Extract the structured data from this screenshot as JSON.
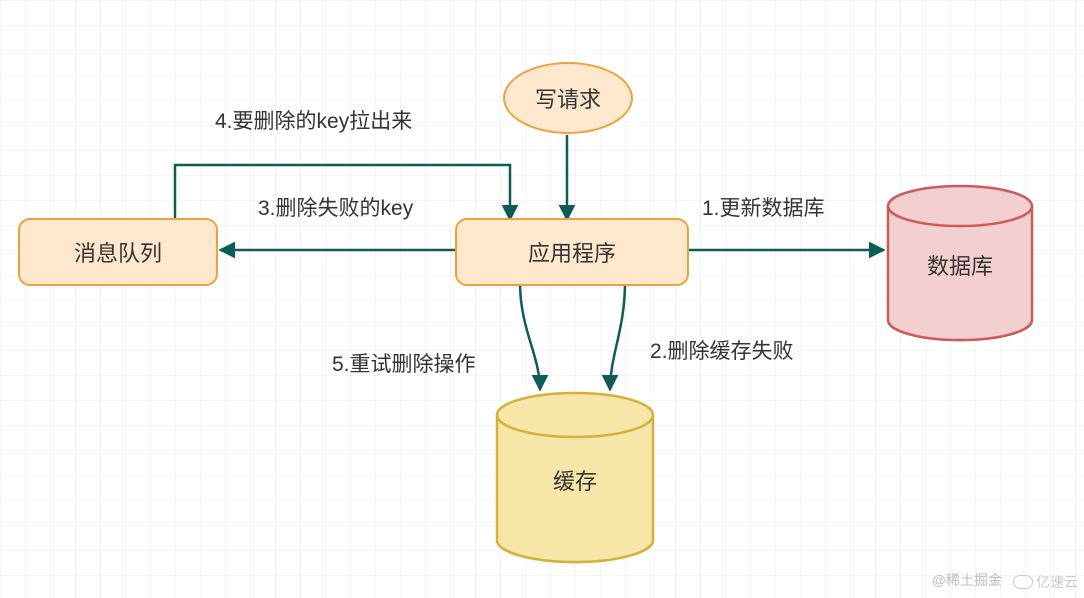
{
  "nodes": {
    "write_request": "写请求",
    "message_queue": "消息队列",
    "application": "应用程序",
    "database": "数据库",
    "cache": "缓存"
  },
  "edges": {
    "e1": "1.更新数据库",
    "e2": "2.删除缓存失败",
    "e3": "3.删除失败的key",
    "e4": "4.要删除的key拉出来",
    "e5": "5.重试删除操作"
  },
  "watermarks": {
    "w1": "@稀土掘金",
    "w2": "亿速云"
  },
  "colors": {
    "stroke": "#0d5c55",
    "orange_fill": "#fde7cd",
    "orange_border": "#e8a33d",
    "yellow_fill": "#f6e7a9",
    "yellow_border": "#d4b13b",
    "red_fill": "#f4cfcf",
    "red_border": "#cc5a5a"
  }
}
